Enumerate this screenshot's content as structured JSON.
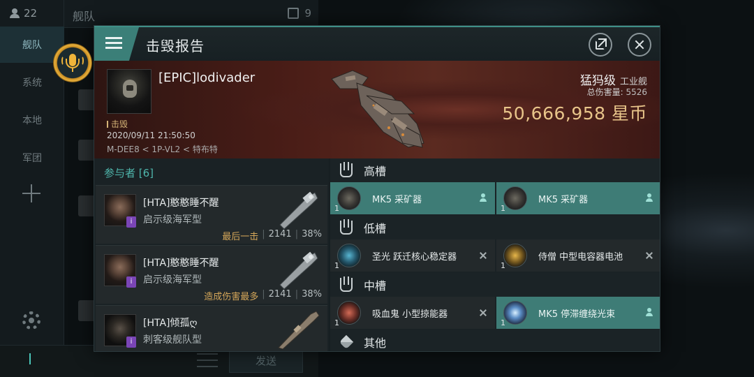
{
  "background": {
    "online_count": "22",
    "top_title": "舰队",
    "top_count": "9",
    "sidebar": [
      {
        "label": "舰队",
        "active": true
      },
      {
        "label": "系统",
        "active": false
      },
      {
        "label": "本地",
        "active": false
      },
      {
        "label": "军团",
        "active": false
      }
    ],
    "send_label": "发送"
  },
  "dialog": {
    "title": "击毁报告",
    "victim": {
      "name": "[EPIC]lodivader",
      "status": "击毁",
      "time": "2020/09/11 21:50:50",
      "location": "M-DEE8 < 1P-VL2 < 特布特",
      "ship_class": "猛犸级",
      "ship_type": "工业舰",
      "total_damage_label": "总伤害量:",
      "total_damage": "5526",
      "value": "50,666,958 星币"
    },
    "participants": {
      "header": "参与者 [6]",
      "rows": [
        {
          "name": "[HTA]憨憨睡不醒",
          "ship": "启示级海军型",
          "tag": "最后一击",
          "damage": "2141",
          "percent": "38%"
        },
        {
          "name": "[HTA]憨憨睡不醒",
          "ship": "启示级海军型",
          "tag": "造成伤害最多",
          "damage": "2141",
          "percent": "38%"
        },
        {
          "name": "[HTA]倾孤ღ",
          "ship": "刺客级舰队型",
          "tag": "",
          "damage": "",
          "percent": ""
        }
      ]
    },
    "fitting": {
      "high": {
        "label": "高槽",
        "modules": [
          {
            "name": "MK5 采矿器",
            "qty": "1",
            "state": "dropped"
          },
          {
            "name": "MK5 采矿器",
            "qty": "1",
            "state": "dropped"
          }
        ]
      },
      "low": {
        "label": "低槽",
        "modules": [
          {
            "name": "圣光 跃迁核心稳定器",
            "qty": "1",
            "state": "destroyed"
          },
          {
            "name": "侍僧 中型电容器电池",
            "qty": "1",
            "state": "destroyed"
          }
        ]
      },
      "mid": {
        "label": "中槽",
        "modules": [
          {
            "name": "吸血鬼 小型掠能器",
            "qty": "1",
            "state": "destroyed"
          },
          {
            "name": "MK5 停滞缠绕光束",
            "qty": "1",
            "state": "dropped"
          }
        ]
      },
      "other": {
        "label": "其他"
      }
    },
    "colors": {
      "accent_teal": "#3e7c76",
      "value_gold": "#e8c58a",
      "participants_header": "#4fb6ac",
      "tag_gold": "#d4a659",
      "banner_red": "#4a1d17"
    }
  }
}
